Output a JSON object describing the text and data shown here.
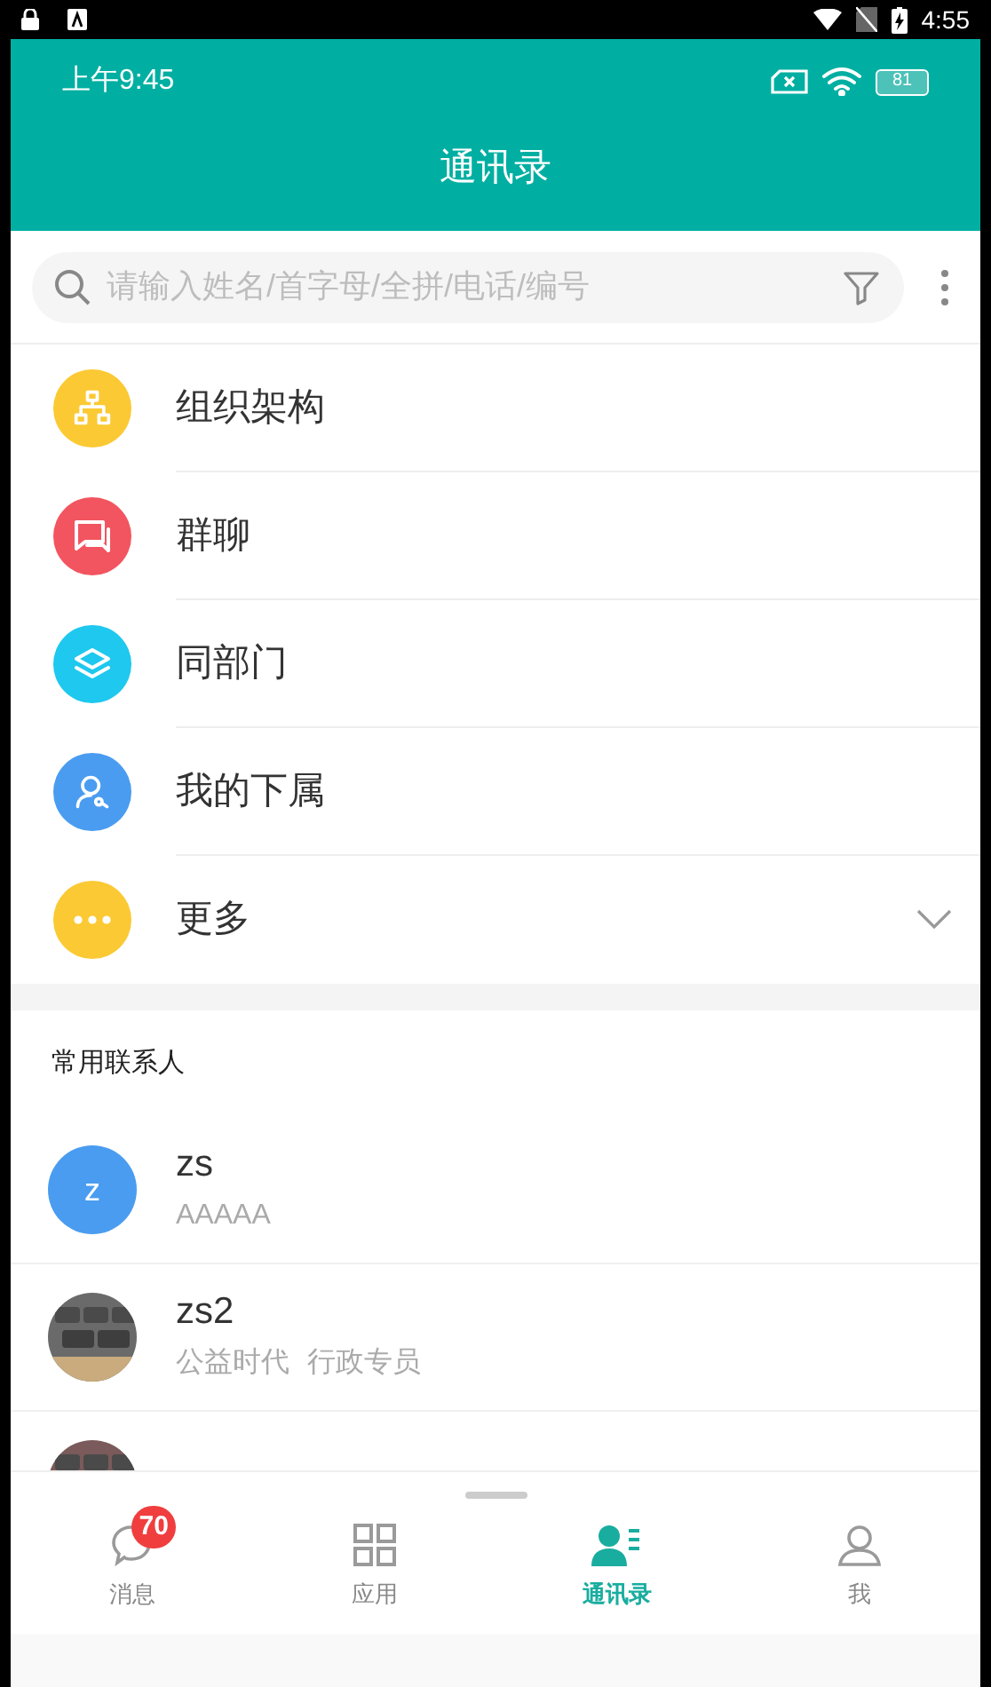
{
  "system_status_bar": {
    "time": "4:55"
  },
  "app_status_bar": {
    "time": "上午9:45",
    "battery": "81"
  },
  "header": {
    "title": "通讯录"
  },
  "search": {
    "placeholder": "请输入姓名/首字母/全拼/电话/编号"
  },
  "menu": [
    {
      "label": "组织架构",
      "kind": "org",
      "color": "#fbc933"
    },
    {
      "label": "群聊",
      "kind": "chat",
      "color": "#f2555f"
    },
    {
      "label": "同部门",
      "kind": "layers",
      "color": "#1ec8ee"
    },
    {
      "label": "我的下属",
      "kind": "person",
      "color": "#4a9cf0"
    }
  ],
  "more": {
    "label": "更多",
    "color": "#fbc933",
    "expanded": false
  },
  "section_title": "常用联系人",
  "contacts": [
    {
      "name": "zs",
      "subtitle": [
        "AAAAA"
      ],
      "avatar": {
        "kind": "letter",
        "text": "z",
        "color": "#4a9cf0"
      }
    },
    {
      "name": "zs2",
      "subtitle": [
        "公益时代",
        "行政专员"
      ],
      "avatar": {
        "kind": "picture"
      }
    },
    {
      "avatar": {
        "kind": "picture"
      }
    }
  ],
  "tabs": [
    {
      "label": "消息",
      "kind": "chat",
      "badge": "70",
      "selected": false
    },
    {
      "label": "应用",
      "kind": "grid",
      "selected": false
    },
    {
      "label": "通讯录",
      "kind": "contacts",
      "selected": true
    },
    {
      "label": "我",
      "kind": "user",
      "selected": false
    }
  ]
}
